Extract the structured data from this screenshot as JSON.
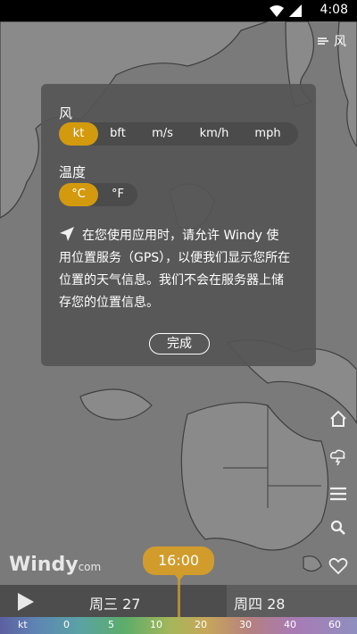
{
  "status": {
    "time": "4:08"
  },
  "map": {
    "layer_label": "风"
  },
  "settings": {
    "wind_label": "风",
    "wind_units": [
      "kt",
      "bft",
      "m/s",
      "km/h",
      "mph"
    ],
    "wind_selected": "kt",
    "temp_label": "温度",
    "temp_units": [
      "°C",
      "°F"
    ],
    "temp_selected": "°C",
    "gps_message": "在您使用应用时，请允许 Windy 使用位置服务（GPS），以便我们显示您所在位置的天气信息。我们不会在服务器上储存您的位置信息。",
    "done_label": "完成"
  },
  "branding": {
    "logo": "Windy",
    "logo_suffix": "com"
  },
  "timeline": {
    "current_time": "16:00",
    "day1": "周三 27",
    "day2": "周四 28"
  },
  "legend": {
    "unit": "kt",
    "values": [
      "0",
      "5",
      "10",
      "20",
      "30",
      "40",
      "60"
    ]
  }
}
